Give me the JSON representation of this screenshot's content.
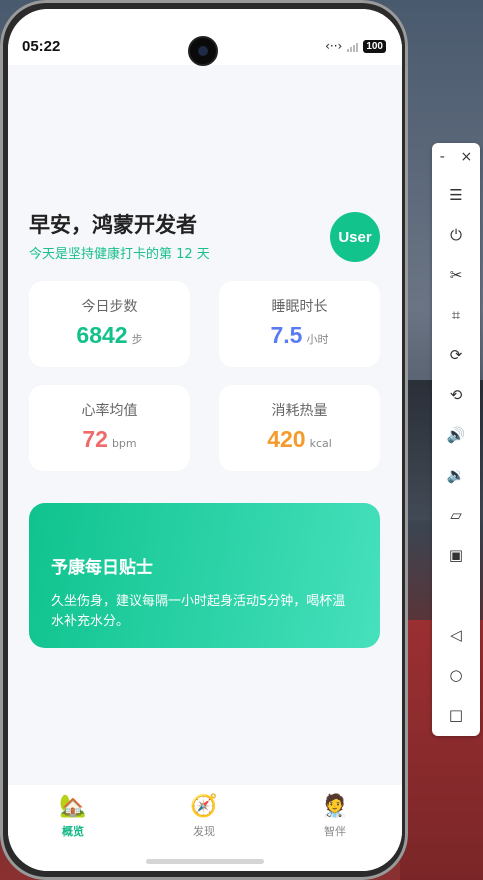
{
  "status": {
    "time": "05:22",
    "battery": "100",
    "network_icon": "data-transfer-icon"
  },
  "greeting": {
    "title": "早安，鸿蒙开发者",
    "subtitle": "今天是坚持健康打卡的第 12 天"
  },
  "avatar": {
    "label": "User"
  },
  "stats": [
    {
      "label": "今日步数",
      "value": "6842",
      "unit": "步",
      "color": "#12c08a"
    },
    {
      "label": "睡眠时长",
      "value": "7.5",
      "unit": "小时",
      "color": "#5b7cf0"
    },
    {
      "label": "心率均值",
      "value": "72",
      "unit": "bpm",
      "color": "#ef6b6b"
    },
    {
      "label": "消耗热量",
      "value": "420",
      "unit": "kcal",
      "color": "#f59a2c"
    }
  ],
  "tip": {
    "title": "予康每日贴士",
    "body": "久坐伤身，建议每隔一小时起身活动5分钟，喝杯温水补充水分。"
  },
  "tabs": [
    {
      "label": "概览",
      "icon": "house-icon",
      "active": true
    },
    {
      "label": "发现",
      "icon": "compass-icon",
      "active": false
    },
    {
      "label": "智伴",
      "icon": "doctor-icon",
      "active": false
    }
  ],
  "toolbar": {
    "minimize": "-",
    "close": "×",
    "buttons": [
      "menu-icon",
      "power-icon",
      "screenshot-icon",
      "crop-icon",
      "rotate-icon",
      "rotate-alt-icon",
      "volume-up-icon",
      "volume-down-icon",
      "fold-icon",
      "multi-screen-icon",
      "back-icon",
      "home-icon",
      "recent-icon"
    ]
  }
}
